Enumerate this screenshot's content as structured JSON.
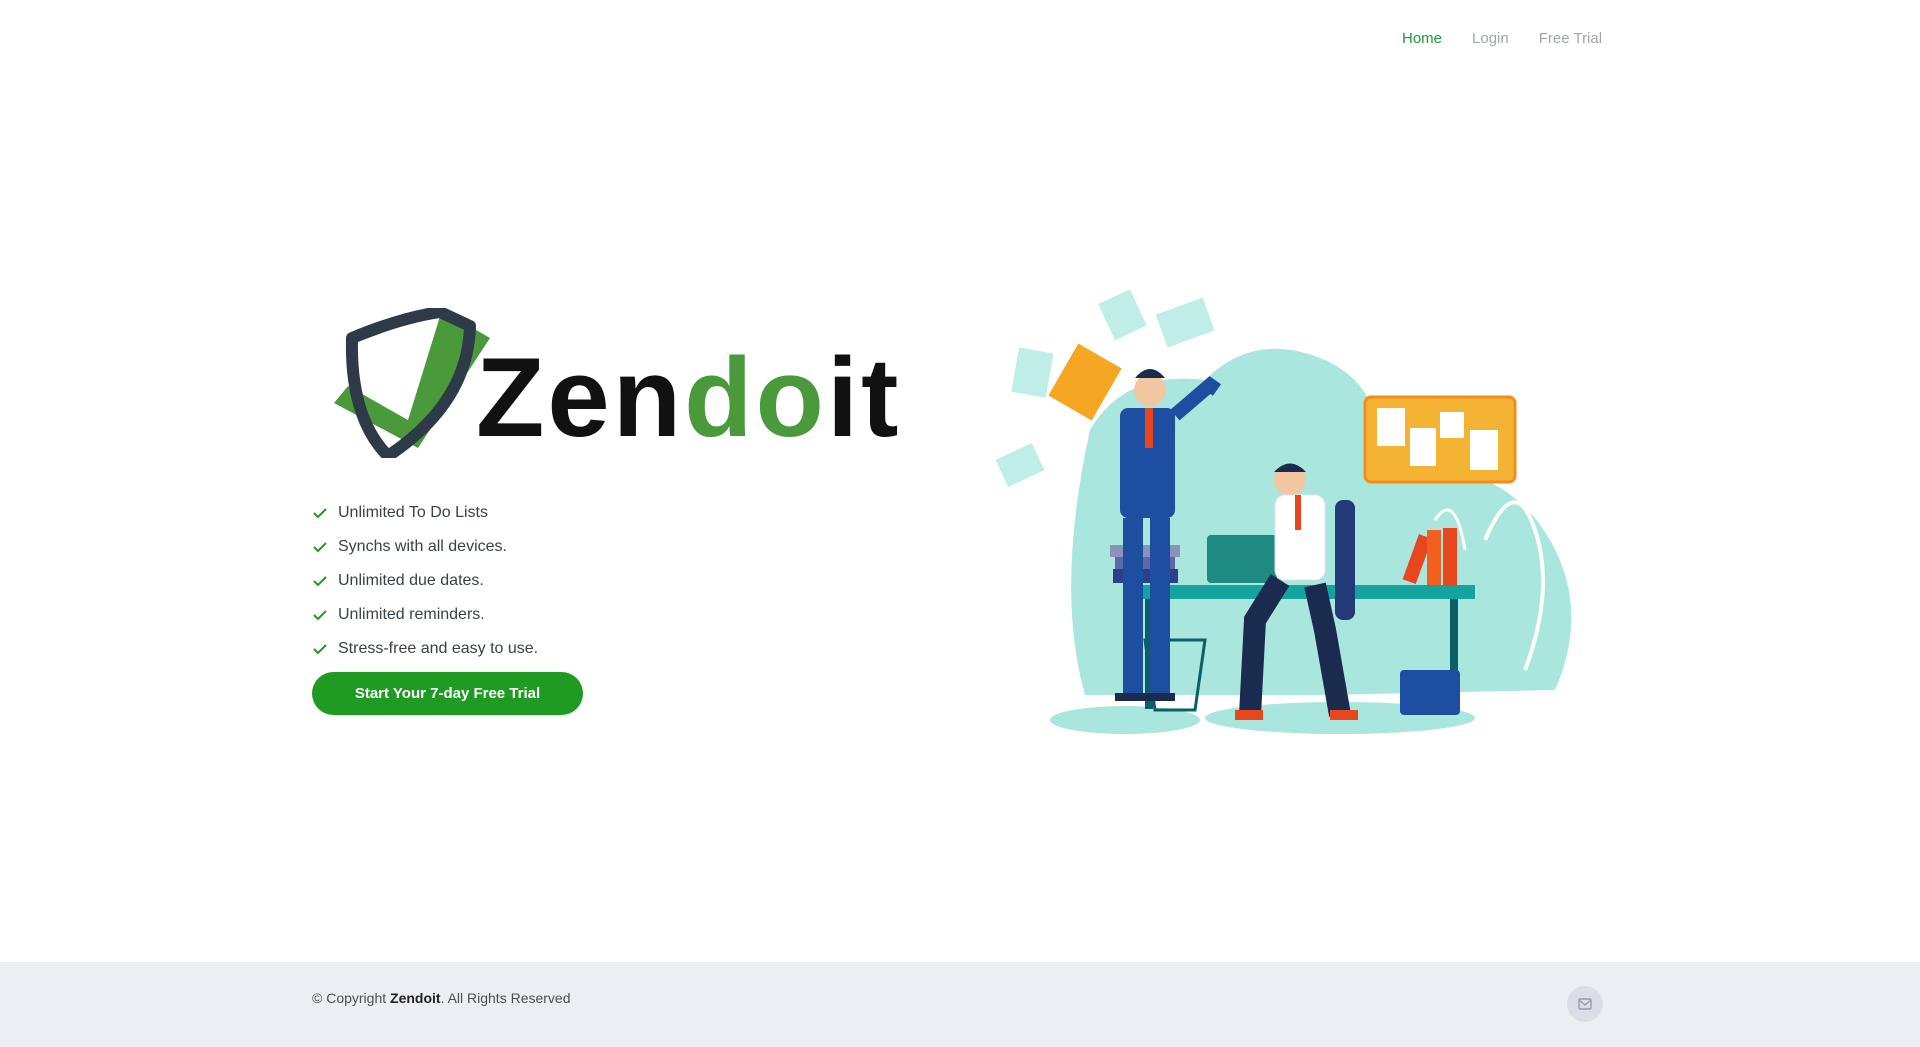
{
  "nav": {
    "items": [
      {
        "label": "Home",
        "active": true
      },
      {
        "label": "Login",
        "active": false
      },
      {
        "label": "Free Trial",
        "active": false
      }
    ]
  },
  "hero": {
    "brand_part1": "Zen",
    "brand_part2": "do",
    "brand_part3": "it",
    "features": [
      "Unlimited To Do Lists",
      "Synchs with all devices.",
      "Unlimited due dates.",
      "Unlimited reminders.",
      "Stress-free and easy to use."
    ],
    "cta_label": "Start Your 7-day Free Trial"
  },
  "footer": {
    "copyright_prefix": "© Copyright ",
    "copyright_brand": "Zendoit",
    "copyright_suffix": ". All Rights Reserved"
  },
  "colors": {
    "accent": "#1f9a22",
    "logo_green": "#4a9a3c",
    "logo_dark": "#2f3a48",
    "illustration_teal": "#a9e6dd"
  },
  "icons": [
    "check-icon",
    "mail-icon",
    "shield-check-icon"
  ]
}
